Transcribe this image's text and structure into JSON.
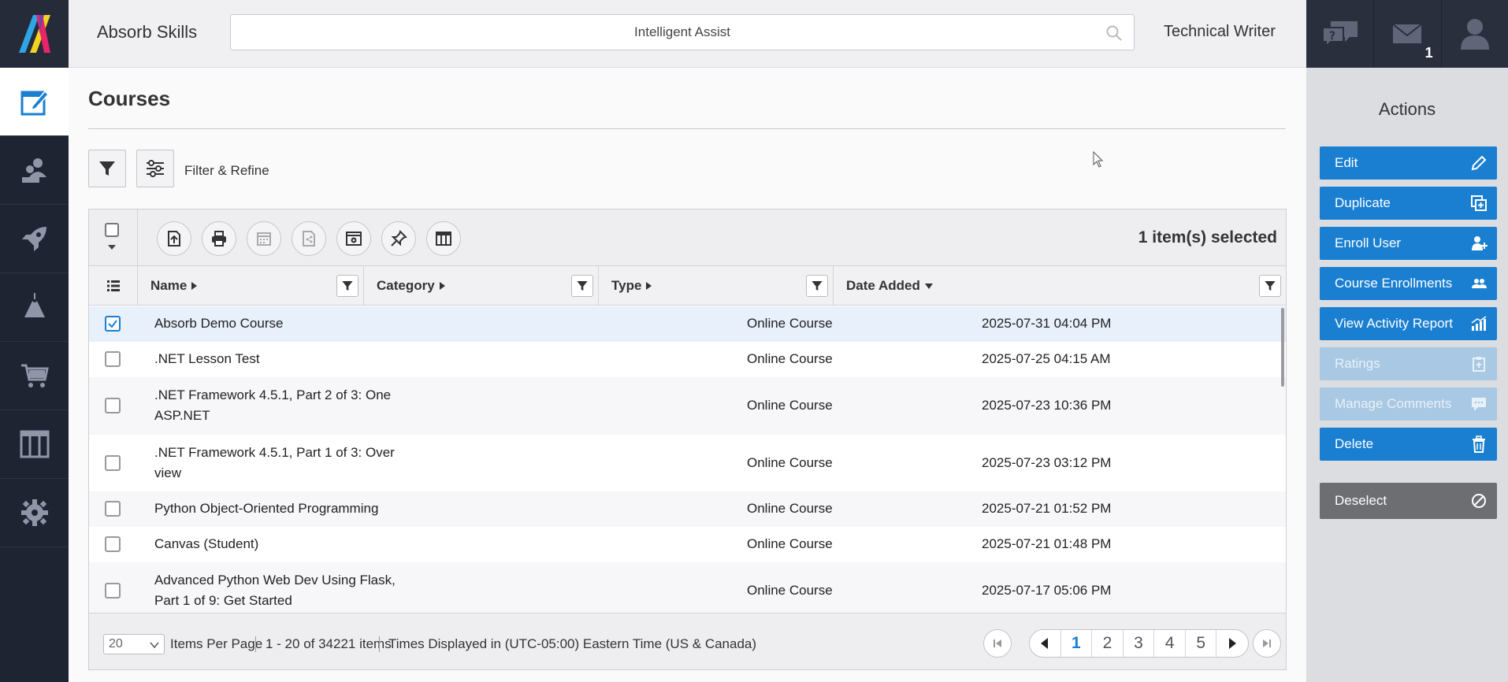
{
  "app": {
    "brand": "Absorb Skills",
    "role": "Technical Writer"
  },
  "search": {
    "text": "Intelligent Assist"
  },
  "notifications": {
    "mail_count": "1"
  },
  "page": {
    "title": "Courses",
    "filter_label": "Filter & Refine"
  },
  "grid": {
    "selected_text": "1 item(s) selected",
    "columns": [
      "Name",
      "Category",
      "Type",
      "Date Added"
    ],
    "rows": [
      {
        "name": "Absorb Demo Course",
        "type": "Online Course",
        "date": "2025-07-31 04:04 PM",
        "checked": true
      },
      {
        "name": ".NET Lesson Test",
        "type": "Online Course",
        "date": "2025-07-25 04:15 AM",
        "checked": false
      },
      {
        "name": ".NET Framework 4.5.1, Part 2 of 3: One ASP.NET",
        "type": "Online Course",
        "date": "2025-07-23 10:36 PM",
        "checked": false
      },
      {
        "name": ".NET Framework 4.5.1, Part 1 of 3: Over view",
        "type": "Online Course",
        "date": "2025-07-23 03:12 PM",
        "checked": false
      },
      {
        "name": "Python Object-Oriented Programming",
        "type": "Online Course",
        "date": "2025-07-21 01:52 PM",
        "checked": false
      },
      {
        "name": "Canvas (Student)",
        "type": "Online Course",
        "date": "2025-07-21 01:48 PM",
        "checked": false
      },
      {
        "name": "Advanced Python Web Dev Using Flask, Part 1 of 9: Get Started",
        "type": "Online Course",
        "date": "2025-07-17 05:06 PM",
        "checked": false
      }
    ]
  },
  "footer": {
    "per_page": "20",
    "per_page_label": "Items Per Page",
    "range": "1 - 20 of 34221 items",
    "timezone": "Times Displayed in (UTC-05:00) Eastern Time (US & Canada)",
    "pages": [
      "1",
      "2",
      "3",
      "4",
      "5"
    ],
    "current_page": "1"
  },
  "actions": {
    "title": "Actions",
    "buttons": [
      {
        "label": "Edit",
        "icon": "pencil-icon",
        "enabled": true
      },
      {
        "label": "Duplicate",
        "icon": "duplicate-icon",
        "enabled": true
      },
      {
        "label": "Enroll User",
        "icon": "add-user-icon",
        "enabled": true
      },
      {
        "label": "Course Enrollments",
        "icon": "users-icon",
        "enabled": true
      },
      {
        "label": "View Activity Report",
        "icon": "bar-chart-icon",
        "enabled": true
      },
      {
        "label": "Ratings",
        "icon": "clipboard-icon",
        "enabled": false
      },
      {
        "label": "Manage Comments",
        "icon": "comment-icon",
        "enabled": false
      },
      {
        "label": "Delete",
        "icon": "trash-icon",
        "enabled": true
      }
    ],
    "deselect_label": "Deselect"
  },
  "colors": {
    "accent": "#1a7fd1",
    "nav_bg": "#1f2433",
    "actions_bg": "#dcdde1"
  }
}
